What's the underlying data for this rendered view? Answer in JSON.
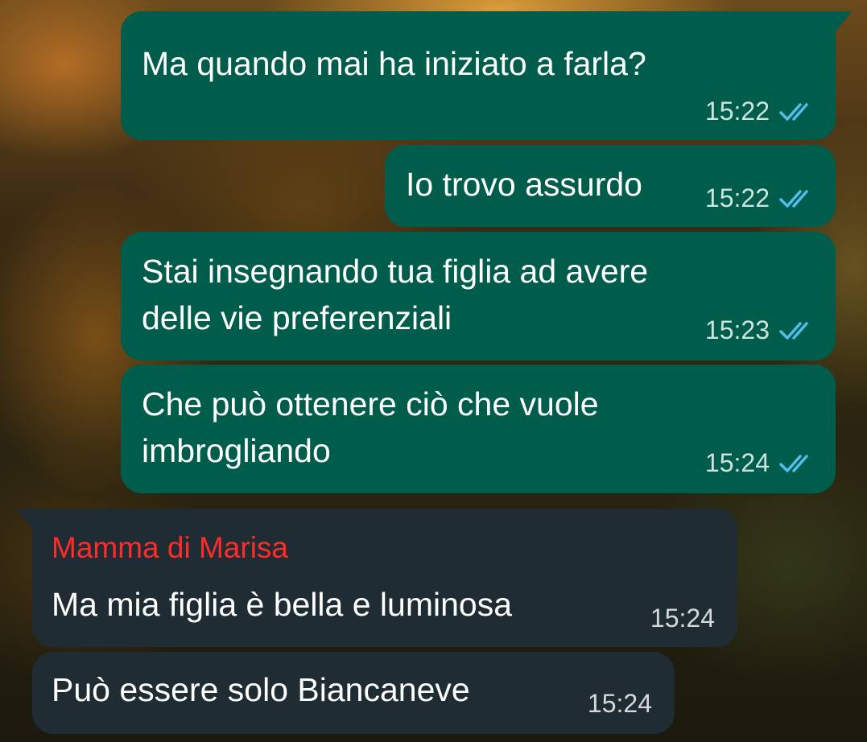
{
  "messages": [
    {
      "text": "Ma quando mai ha iniziato a farla?",
      "time": "15:22",
      "direction": "outgoing",
      "status": "read"
    },
    {
      "text": "Io trovo assurdo",
      "time": "15:22",
      "direction": "outgoing",
      "status": "read"
    },
    {
      "line1": "Stai insegnando tua figlia ad avere",
      "line2": "delle vie preferenziali",
      "time": "15:23",
      "direction": "outgoing",
      "status": "read"
    },
    {
      "line1": "Che può ottenere ciò che vuole",
      "line2": "imbrogliando",
      "time": "15:24",
      "direction": "outgoing",
      "status": "read"
    },
    {
      "sender": "Mamma di Marisa",
      "text": "Ma mia figlia è bella e luminosa",
      "time": "15:24",
      "direction": "incoming"
    },
    {
      "text": "Può essere solo Biancaneve",
      "time": "15:24",
      "direction": "incoming"
    }
  ],
  "colors": {
    "outgoing_bubble": "#005c4b",
    "incoming_bubble": "#1f2c33",
    "read_ticks": "#53bdeb",
    "sender_name": "#ff2a2a"
  },
  "icons": {
    "read_receipt": "double-check-icon"
  }
}
